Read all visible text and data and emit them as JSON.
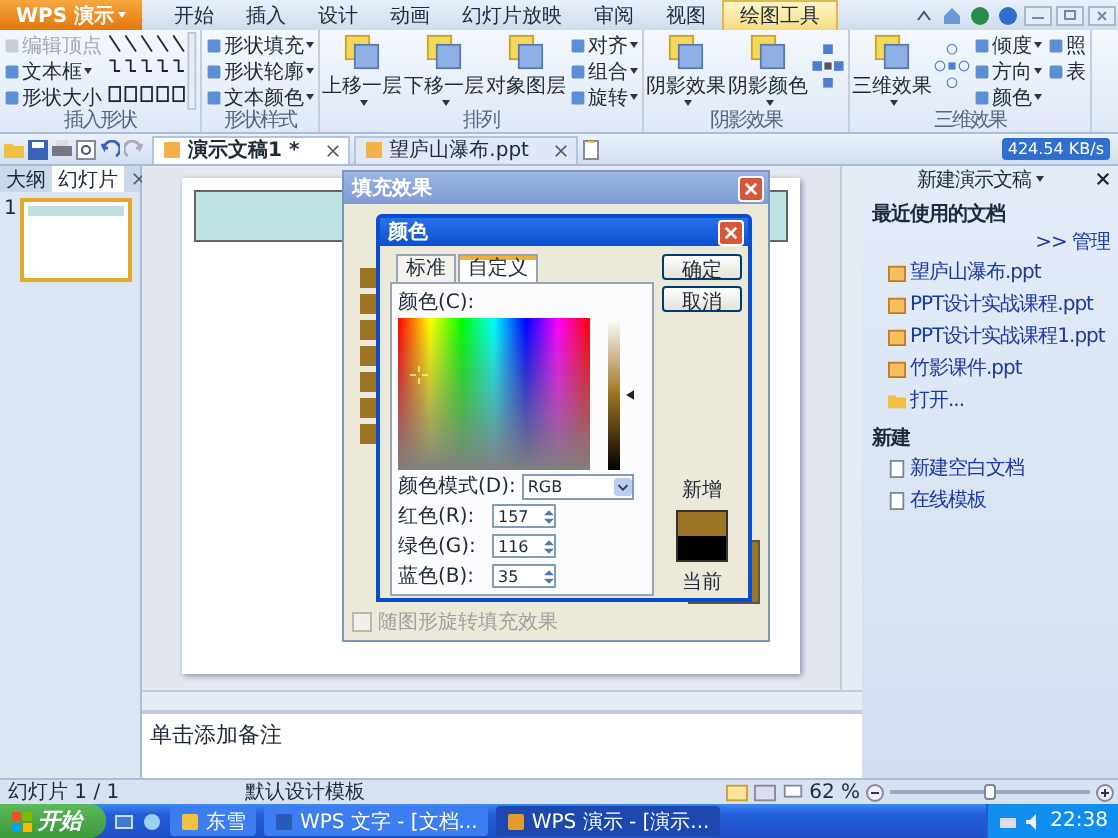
{
  "app_button": "WPS 演示",
  "ribbon_tabs": [
    {
      "label": "开始",
      "selected": false
    },
    {
      "label": "插入",
      "selected": false
    },
    {
      "label": "设计",
      "selected": false
    },
    {
      "label": "动画",
      "selected": false
    },
    {
      "label": "幻灯片放映",
      "selected": false
    },
    {
      "label": "审阅",
      "selected": false
    },
    {
      "label": "视图",
      "selected": false
    },
    {
      "label": "绘图工具",
      "selected": true
    }
  ],
  "ribbon_groups": [
    {
      "label": "插入形状",
      "columns": [
        {
          "kind": "small",
          "entries": [
            {
              "label": "编辑顶点",
              "disabled": true,
              "dropdown": false
            },
            {
              "label": "文本框",
              "disabled": false,
              "dropdown": true
            },
            {
              "label": "形状大小",
              "disabled": false,
              "dropdown": false
            }
          ]
        },
        {
          "kind": "shapes"
        }
      ]
    },
    {
      "label": "形状样式",
      "columns": [
        {
          "kind": "small",
          "entries": [
            {
              "label": "形状填充",
              "disabled": false,
              "dropdown": true
            },
            {
              "label": "形状轮廓",
              "disabled": false,
              "dropdown": true
            },
            {
              "label": "文本颜色",
              "disabled": false,
              "dropdown": true
            }
          ]
        }
      ]
    },
    {
      "label": "排列",
      "columns": [
        {
          "kind": "large",
          "label": "上移一层",
          "dropdown": true
        },
        {
          "kind": "large",
          "label": "下移一层",
          "dropdown": true
        },
        {
          "kind": "large",
          "label": "对象图层",
          "dropdown": false
        },
        {
          "kind": "small",
          "entries": [
            {
              "label": "对齐",
              "disabled": false,
              "dropdown": true
            },
            {
              "label": "组合",
              "disabled": false,
              "dropdown": true
            },
            {
              "label": "旋转",
              "disabled": false,
              "dropdown": true
            }
          ]
        }
      ]
    },
    {
      "label": "阴影效果",
      "columns": [
        {
          "kind": "large",
          "label": "阴影效果",
          "dropdown": true
        },
        {
          "kind": "large",
          "label": "阴影颜色",
          "dropdown": true
        },
        {
          "kind": "nudge"
        }
      ]
    },
    {
      "label": "三维效果",
      "columns": [
        {
          "kind": "large",
          "label": "三维效果",
          "dropdown": true
        },
        {
          "kind": "tilt"
        },
        {
          "kind": "small",
          "entries": [
            {
              "label": "倾度",
              "disabled": false,
              "dropdown": true
            },
            {
              "label": "方向",
              "disabled": false,
              "dropdown": true
            },
            {
              "label": "颜色",
              "disabled": false,
              "dropdown": true
            }
          ]
        },
        {
          "kind": "small",
          "entries": [
            {
              "label": "照",
              "disabled": false,
              "dropdown": false
            },
            {
              "label": "表",
              "disabled": false,
              "dropdown": false
            }
          ]
        }
      ]
    }
  ],
  "doc_tabs": [
    {
      "label": "演示文稿1 *",
      "selected": true
    },
    {
      "label": "望庐山瀑布.ppt",
      "selected": false
    }
  ],
  "speed": "424.54 KB/s",
  "left_tabs": [
    {
      "label": "大纲",
      "selected": false
    },
    {
      "label": "幻灯片",
      "selected": true
    }
  ],
  "thumbnails": [
    {
      "number": "1",
      "selected": true
    }
  ],
  "fill_dialog": {
    "title": "填充效果",
    "checkbox": {
      "label": "随图形旋转填充效果",
      "checked": false,
      "disabled": true
    }
  },
  "color_dialog": {
    "title": "颜色",
    "tabs": [
      {
        "label": "标准",
        "selected": false
      },
      {
        "label": "自定义",
        "selected": true
      }
    ],
    "colors_label": "颜色(C):",
    "mode_label": "颜色模式(D):",
    "mode": "RGB",
    "channels": [
      {
        "label": "红色(R):",
        "value": "157"
      },
      {
        "label": "绿色(G):",
        "value": "116"
      },
      {
        "label": "蓝色(B):",
        "value": "35"
      }
    ],
    "buttons": [
      "确定",
      "取消"
    ],
    "new_label": "新增",
    "current_label": "当前",
    "swatches": [
      {
        "color": "#9d7423"
      },
      {
        "color": "#000000"
      }
    ]
  },
  "notes_placeholder": "单击添加备注",
  "task_pane": {
    "title": "新建演示文稿",
    "recent_heading": "最近使用的文档",
    "manage": ">> 管理",
    "recent": [
      "望庐山瀑布.ppt",
      "PPT设计实战课程.ppt",
      "PPT设计实战课程1.ppt",
      "竹影课件.ppt"
    ],
    "open": "打开...",
    "new_heading": "新建",
    "new_items": [
      "新建空白文档",
      "在线模板"
    ]
  },
  "status": {
    "slide": "幻灯片 1 / 1",
    "template": "默认设计模板",
    "zoom": "62 %",
    "level": 0.5
  },
  "taskbar": {
    "start": "开始",
    "tasks": [
      {
        "label": "东雪",
        "selected": false
      },
      {
        "label": "WPS 文字 - [文档...",
        "selected": false
      },
      {
        "label": "WPS 演示 - [演示...",
        "selected": true
      }
    ],
    "time": "22:38"
  }
}
